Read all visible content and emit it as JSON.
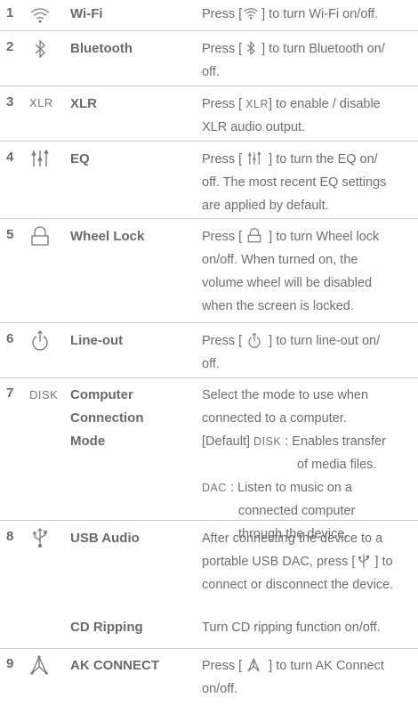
{
  "rows": [
    {
      "num": "1",
      "icon": "wifi-icon",
      "name": "Wi-Fi",
      "desc_pre": "Press [",
      "desc_post": "] to turn Wi-Fi on/off."
    },
    {
      "num": "2",
      "icon": "bluetooth-icon",
      "name": "Bluetooth",
      "desc_pre": "Press [",
      "desc_post": "] to turn Bluetooth on/",
      "desc_line2": "off."
    },
    {
      "num": "3",
      "icon_text": "XLR",
      "name": "XLR",
      "desc_pre": "Press [ ",
      "desc_inline_text": "XLR",
      "desc_post": "] to enable / disable",
      "desc_line2": "XLR audio output."
    },
    {
      "num": "4",
      "icon": "eq-icon",
      "name": "EQ",
      "desc_pre": "Press [ ",
      "desc_post": " ] to turn the EQ on/",
      "desc_line2": "off. The most recent EQ settings",
      "desc_line3": "are applied by default."
    },
    {
      "num": "5",
      "icon": "lock-icon",
      "name": "Wheel Lock",
      "desc_pre": "Press [ ",
      "desc_post": " ] to turn Wheel lock",
      "desc_line2": "on/off. When turned on, the",
      "desc_line3": "volume wheel will be disabled",
      "desc_line4": "when the screen is locked."
    },
    {
      "num": "6",
      "icon": "line-out-icon",
      "name": "Line-out",
      "desc_pre": "Press [ ",
      "desc_post": " ] to turn line-out on/",
      "desc_line2": "off."
    },
    {
      "num": "7",
      "icon_text": "DISK",
      "name_line1": "Computer",
      "name_line2": "Connection",
      "name_line3": "Mode",
      "desc_line1": "Select the mode to use when",
      "desc_line2": "connected to a computer.",
      "default_label": "[Default]",
      "disk_label": "DISK",
      "disk_desc": ": Enables transfer",
      "disk_desc2": "of media files.",
      "dac_label": "DAC",
      "dac_desc": ": Listen to music on a",
      "dac_desc2": "connected computer",
      "dac_desc3": "through the device."
    },
    {
      "num": "8",
      "icon": "usb-icon",
      "name": "USB Audio",
      "desc_line1": "After connecting the device to a",
      "desc_line2": "portable USB DAC, press [",
      "desc_line2_post": "] to",
      "desc_line3": "connect or disconnect the device.",
      "name2": "CD Ripping",
      "desc2": "Turn CD ripping function on/off."
    },
    {
      "num": "9",
      "icon": "ak-connect-icon",
      "name": "AK CONNECT",
      "desc_pre": "Press [ ",
      "desc_post": " ] to turn AK Connect",
      "desc_line2": "on/off."
    }
  ]
}
